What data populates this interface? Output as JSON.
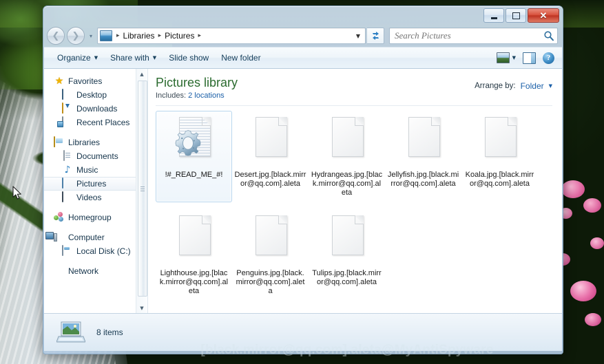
{
  "window": {
    "title": "",
    "minimize_label": "Minimize",
    "maximize_label": "Maximize",
    "close_label": "Close"
  },
  "address_bar": {
    "back_label": "Back",
    "forward_label": "Forward",
    "recent_pages_label": "Recent pages",
    "breadcrumb": [
      "Libraries",
      "Pictures"
    ],
    "breadcrumb_separator": "▸",
    "dropdown_caret": "▼",
    "refresh_label": "Refresh",
    "refresh_glyph": "↻"
  },
  "search": {
    "placeholder": "Search Pictures",
    "value": "",
    "icon": "search-icon"
  },
  "toolbar": {
    "items": [
      {
        "label": "Organize",
        "has_caret": true
      },
      {
        "label": "Share with",
        "has_caret": true
      },
      {
        "label": "Slide show",
        "has_caret": false
      },
      {
        "label": "New folder",
        "has_caret": false
      }
    ],
    "caret": "▼",
    "view_label": "Change your view",
    "view_caret": "▼",
    "preview_pane_label": "Show the preview pane",
    "help_label": "Get help",
    "help_glyph": "?"
  },
  "sidebar": {
    "groups": [
      {
        "header": {
          "label": "Favorites",
          "icon": "star-icon"
        },
        "items": [
          {
            "label": "Desktop",
            "icon": "desktop-monitor-icon"
          },
          {
            "label": "Downloads",
            "icon": "downloads-folder-icon"
          },
          {
            "label": "Recent Places",
            "icon": "recent-places-icon"
          }
        ]
      },
      {
        "header": {
          "label": "Libraries",
          "icon": "libraries-folder-icon"
        },
        "items": [
          {
            "label": "Documents",
            "icon": "document-icon"
          },
          {
            "label": "Music",
            "icon": "music-note-icon"
          },
          {
            "label": "Pictures",
            "icon": "pictures-icon",
            "selected": true
          },
          {
            "label": "Videos",
            "icon": "video-film-icon"
          }
        ]
      },
      {
        "header": {
          "label": "Homegroup",
          "icon": "homegroup-icon"
        },
        "items": []
      },
      {
        "header": {
          "label": "Computer",
          "icon": "computer-icon"
        },
        "items": [
          {
            "label": "Local Disk (C:)",
            "icon": "hard-disk-icon"
          }
        ]
      },
      {
        "header": {
          "label": "Network",
          "icon": "network-globe-icon"
        },
        "items": []
      }
    ],
    "scroll_up_glyph": "▲",
    "scroll_down_glyph": "▼"
  },
  "library": {
    "title": "Pictures library",
    "includes_label": "Includes:",
    "includes_value": "2 locations",
    "arrange_label": "Arrange by:",
    "arrange_value": "Folder",
    "arrange_caret": "▼"
  },
  "files": [
    {
      "name": "!#_READ_ME_#!",
      "icon": "readme-gear-document-icon",
      "selected": true
    },
    {
      "name": "Desert.jpg.[black.mirror@qq.com].aleta",
      "icon": "blank-file-icon",
      "selected": false
    },
    {
      "name": "Hydrangeas.jpg.[black.mirror@qq.com].aleta",
      "icon": "blank-file-icon",
      "selected": false
    },
    {
      "name": "Jellyfish.jpg.[black.mirror@qq.com].aleta",
      "icon": "blank-file-icon",
      "selected": false
    },
    {
      "name": "Koala.jpg.[black.mirror@qq.com].aleta",
      "icon": "blank-file-icon",
      "selected": false
    },
    {
      "name": "Lighthouse.jpg.[black.mirror@qq.com].aleta",
      "icon": "blank-file-icon",
      "selected": false
    },
    {
      "name": "Penguins.jpg.[black.mirror@qq.com].aleta",
      "icon": "blank-file-icon",
      "selected": false
    },
    {
      "name": "Tulips.jpg.[black.mirror@qq.com].aleta",
      "icon": "blank-file-icon",
      "selected": false
    }
  ],
  "status_bar": {
    "item_count_text": "8 items",
    "icon": "computer-preview-icon"
  },
  "watermark": {
    "text": "[black.mirror@qq.com].aleta@MyAntiSpyware"
  },
  "colors": {
    "library_title": "#2b6b2f",
    "link": "#1a5fa8",
    "close_button": "#d9533f",
    "selection_border": "#b8d6ee"
  }
}
